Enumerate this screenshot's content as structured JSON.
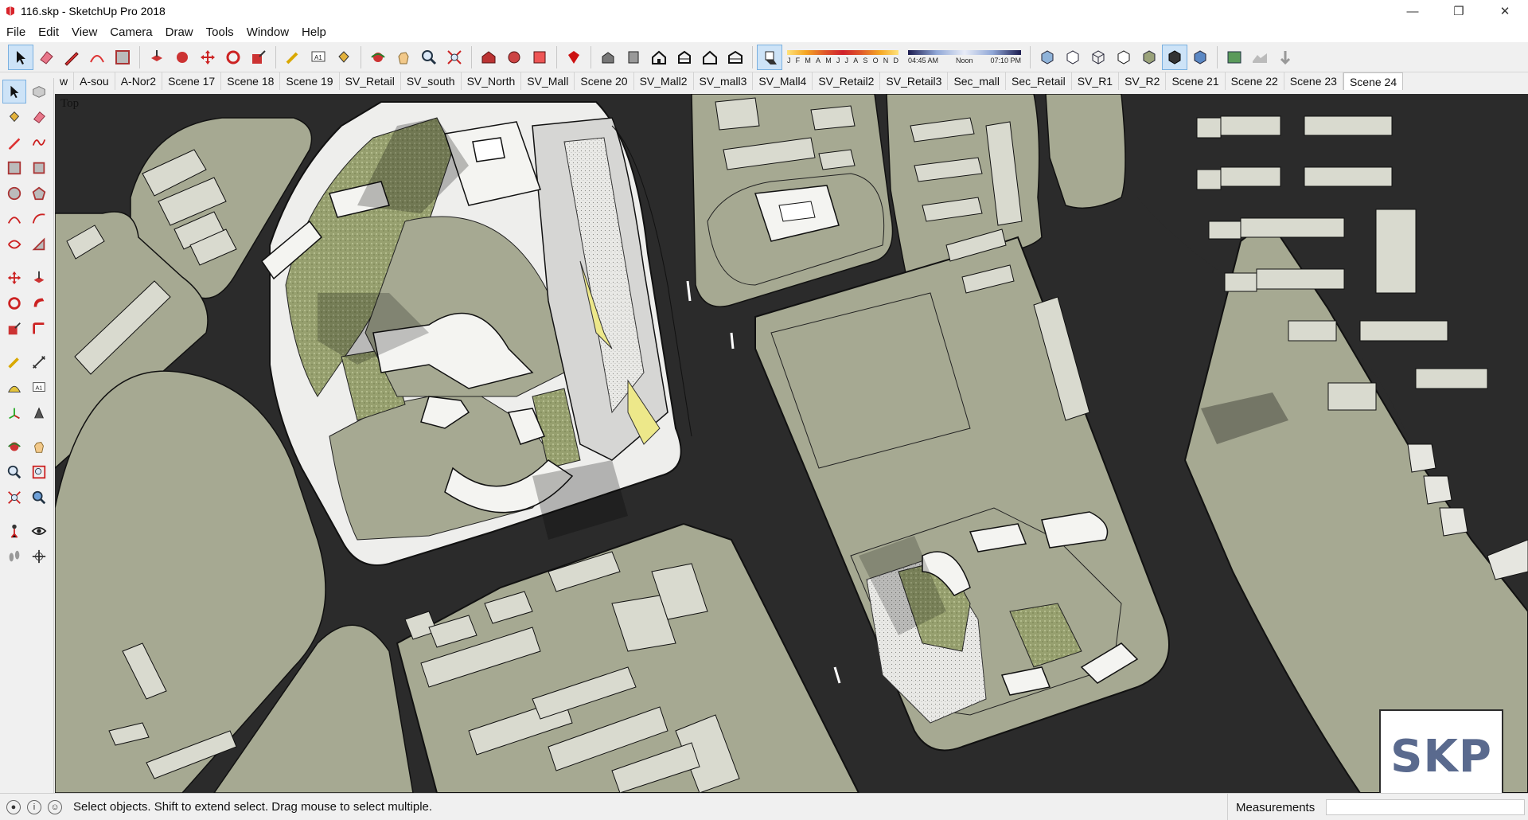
{
  "window": {
    "title": "116.skp - SketchUp Pro 2018"
  },
  "menu": [
    "File",
    "Edit",
    "View",
    "Camera",
    "Draw",
    "Tools",
    "Window",
    "Help"
  ],
  "shadow": {
    "months": [
      "J",
      "F",
      "M",
      "A",
      "M",
      "J",
      "J",
      "A",
      "S",
      "O",
      "N",
      "D"
    ],
    "time_start": "04:45 AM",
    "time_mid": "Noon",
    "time_end": "07:10 PM"
  },
  "scenes": [
    "w",
    "A-sou",
    "A-Nor2",
    "Scene 17",
    "Scene 18",
    "Scene 19",
    "SV_Retail",
    "SV_south",
    "SV_North",
    "SV_Mall",
    "Scene 20",
    "SV_Mall2",
    "SV_mall3",
    "SV_Mall4",
    "SV_Retail2",
    "SV_Retail3",
    "Sec_mall",
    "Sec_Retail",
    "SV_R1",
    "SV_R2",
    "Scene 21",
    "Scene 22",
    "Scene 23",
    "Scene 24"
  ],
  "active_scene": "Scene 24",
  "view_label": "Top",
  "logo": "SKP",
  "status": {
    "message": "Select objects. Shift to extend select. Drag mouse to select multiple.",
    "measurements_label": "Measurements",
    "measurements_value": ""
  },
  "colors": {
    "road": "#2b2b2b",
    "block": "#a8ab93",
    "building": "#d9dacf",
    "accent_blue": "#0078d7"
  }
}
